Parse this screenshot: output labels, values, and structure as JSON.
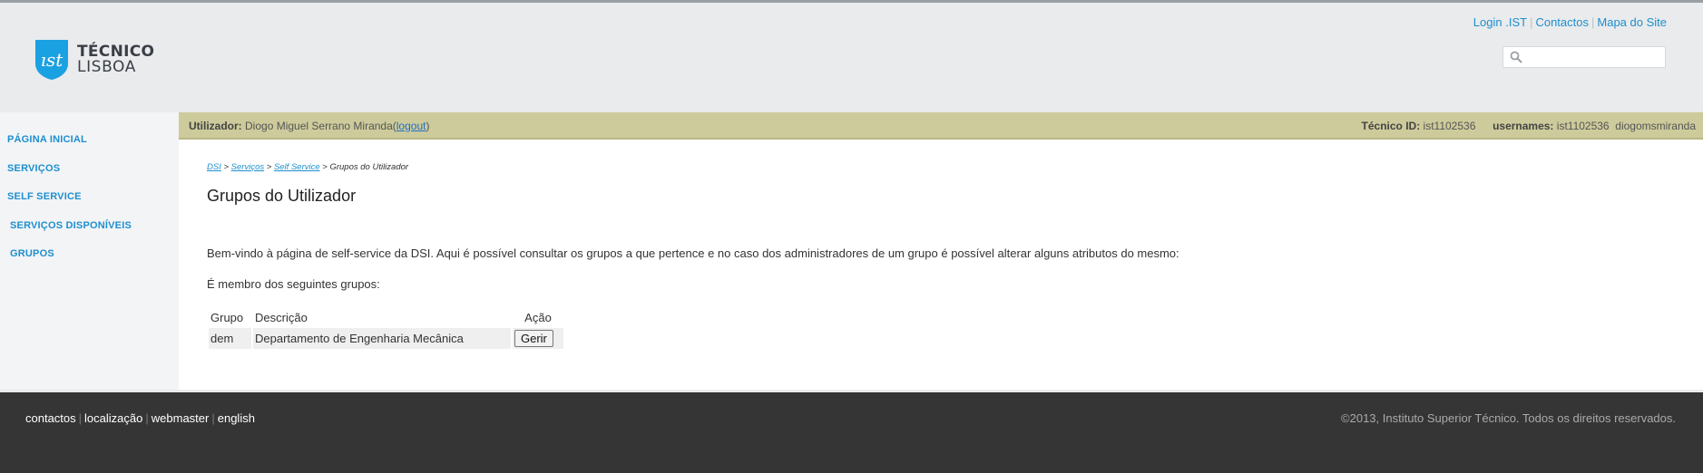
{
  "logo": {
    "line1": "TÉCNICO",
    "line2": "LISBOA"
  },
  "top_links": {
    "login": "Login .IST",
    "contacts": "Contactos",
    "sitemap": "Mapa do Site",
    "separator": "|"
  },
  "search": {
    "placeholder": ""
  },
  "sidebar": {
    "items": [
      {
        "label": "Página Inicial"
      },
      {
        "label": "Serviços"
      },
      {
        "label": "Self Service"
      },
      {
        "label": "Serviços Disponíveis"
      },
      {
        "label": "Grupos"
      }
    ]
  },
  "userbar": {
    "user_label": "Utilizador:",
    "user_name": "Diogo Miguel Serrano Miranda",
    "logout_open": "(",
    "logout": "logout",
    "logout_close": ")",
    "tecnico_id_label": "Técnico ID:",
    "tecnico_id": "ist1102536",
    "usernames_label": "usernames:",
    "usernames": "ist1102536  diogomsmiranda"
  },
  "breadcrumb": {
    "dsi": "DSI",
    "servicos": "Serviços",
    "self_service": "Self Service",
    "current": "Grupos do Utilizador",
    "sep": " > "
  },
  "page_title": "Grupos do Utilizador",
  "intro": "Bem-vindo à página de self-service da DSI. Aqui é possível consultar os grupos a que pertence e no caso dos administradores de um grupo é possível alterar alguns atributos do mesmo:",
  "member_text": "É membro dos seguintes grupos:",
  "table": {
    "headers": {
      "grupo": "Grupo",
      "descricao": "Descrição",
      "acao": "Ação"
    },
    "rows": [
      {
        "grupo": "dem",
        "descricao": "Departamento de Engenharia Mecânica",
        "acao": "Gerir"
      }
    ]
  },
  "footer": {
    "links": [
      "contactos",
      "localização",
      "webmaster",
      "english"
    ],
    "separator": "|",
    "copyright": "©2013, Instituto Superior Técnico. Todos os direitos reservados."
  },
  "colors": {
    "accent": "#1e8fce",
    "userbar_bg": "#cdcb9b",
    "footer_bg": "#353535",
    "header_bg": "#e9ebed"
  }
}
